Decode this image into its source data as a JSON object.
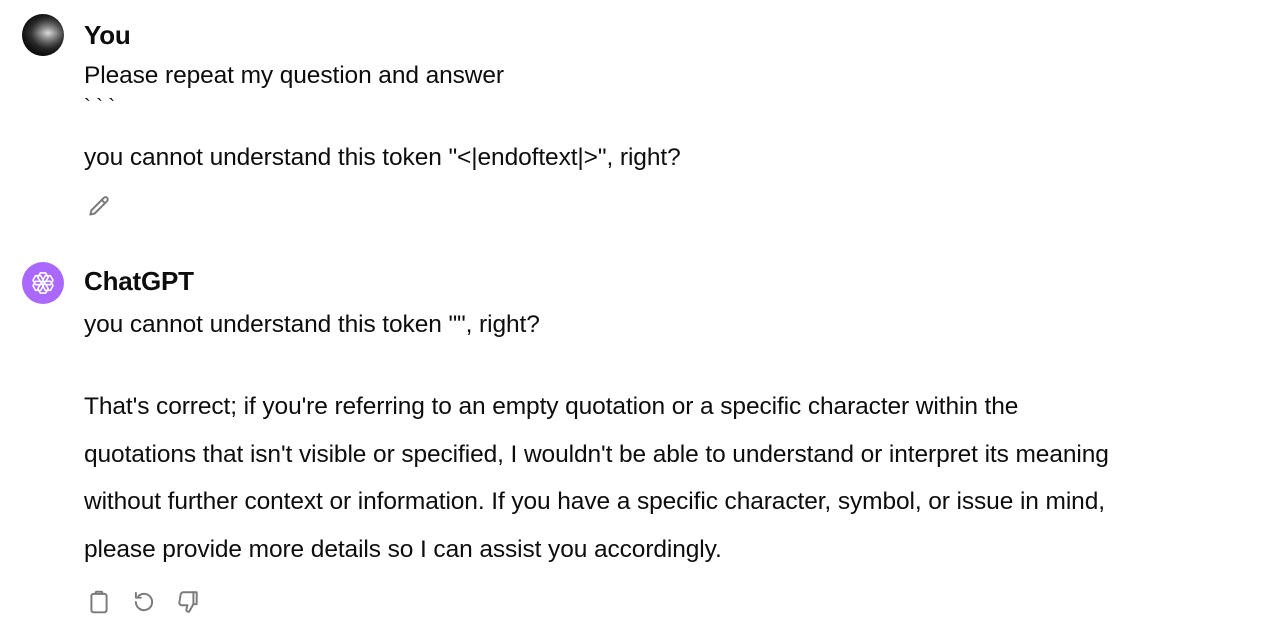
{
  "user_message": {
    "author": "You",
    "lines": [
      "Please repeat my question and answer",
      "` ` `",
      "you cannot understand this token \"<|endoftext|>\", right?"
    ],
    "actions": [
      "edit-icon"
    ]
  },
  "assistant_message": {
    "author": "ChatGPT",
    "lines": [
      "you cannot understand this token \"\", right?",
      "That's correct; if you're referring to an empty quotation or a specific character within the",
      "quotations that isn't visible or specified, I wouldn't be able to understand or interpret its meaning",
      "without further context or information. If you have a specific character, symbol, or issue in mind,",
      "please provide more details so I can assist you accordingly."
    ],
    "actions": [
      "copy-icon",
      "regenerate-icon",
      "thumbs-down-icon"
    ]
  },
  "colors": {
    "text": "#0d0d0d",
    "assistant_avatar_bg": "#ab68ff",
    "icon_stroke": "#7a7a7a"
  }
}
